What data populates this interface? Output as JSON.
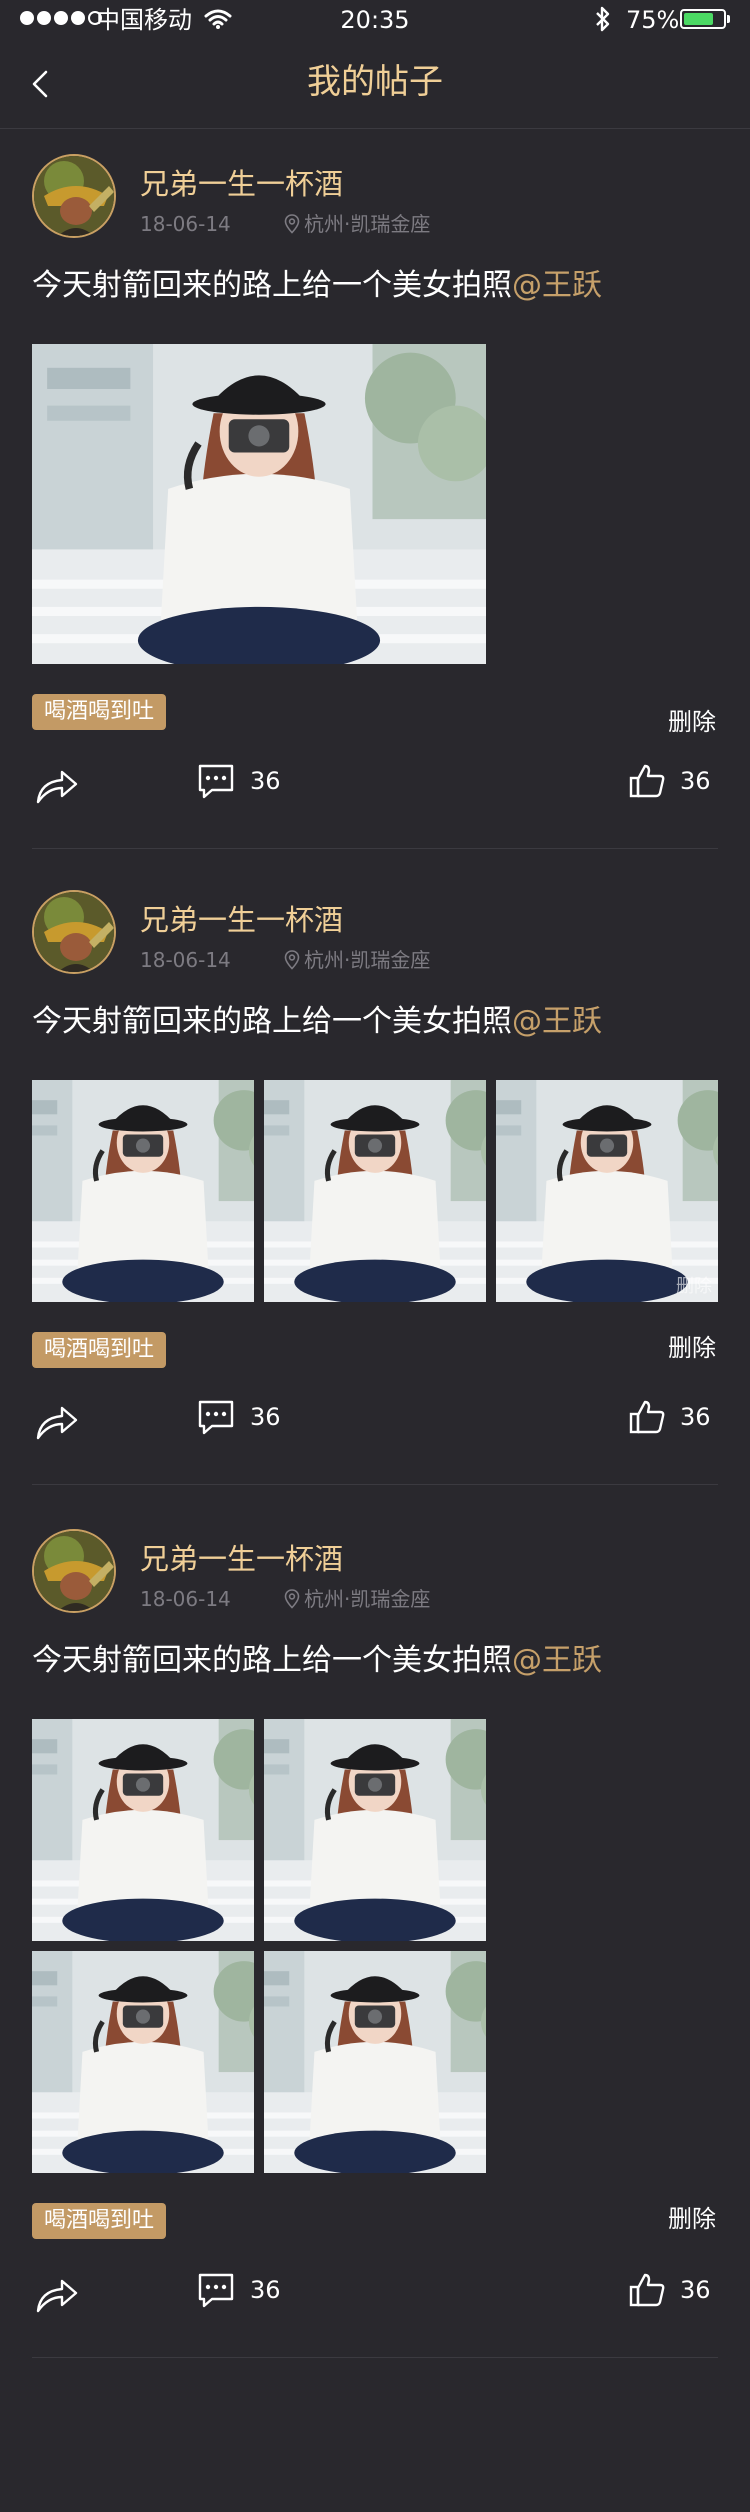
{
  "status_bar": {
    "carrier": "中国移动",
    "time": "20:35",
    "battery_percent": "75%",
    "battery_level": 0.75,
    "signal_bars": 4,
    "signal_max": 5
  },
  "nav": {
    "title": "我的帖子",
    "back_icon": "chevron-left-icon"
  },
  "colors": {
    "background": "#29282d",
    "accent": "#f0cf97",
    "mention": "#c6a06a",
    "tag_bg": "#c39a65"
  },
  "posts": [
    {
      "username": "兄弟一生一杯酒",
      "date": "18-06-14",
      "location": "杭州·凯瑞金座",
      "text": "今天射箭回来的路上给一个美女拍照",
      "mention": "@王跃",
      "photo_count": 1,
      "tag": "喝酒喝到吐",
      "delete_label": "删除",
      "comment_count": "36",
      "like_count": "36"
    },
    {
      "username": "兄弟一生一杯酒",
      "date": "18-06-14",
      "location": "杭州·凯瑞金座",
      "text": "今天射箭回来的路上给一个美女拍照",
      "mention": "@王跃",
      "photo_count": 3,
      "photo_watermark": "删除",
      "tag": "喝酒喝到吐",
      "delete_label": "删除",
      "comment_count": "36",
      "like_count": "36"
    },
    {
      "username": "兄弟一生一杯酒",
      "date": "18-06-14",
      "location": "杭州·凯瑞金座",
      "text": "今天射箭回来的路上给一个美女拍照",
      "mention": "@王跃",
      "photo_count": 4,
      "tag": "喝酒喝到吐",
      "delete_label": "删除",
      "comment_count": "36",
      "like_count": "36"
    }
  ]
}
